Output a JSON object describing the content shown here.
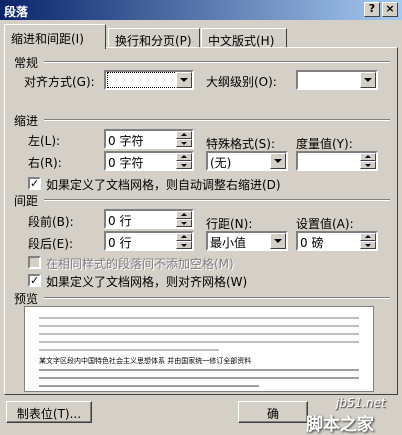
{
  "window": {
    "title": "段落",
    "help_button": "?",
    "close_button": "×"
  },
  "tabs": [
    {
      "label": "缩进和间距(I)"
    },
    {
      "label": "换行和分页(P)"
    },
    {
      "label": "中文版式(H)"
    }
  ],
  "general": {
    "title": "常规",
    "alignment_label": "对齐方式(G):",
    "alignment_value": "",
    "outline_label": "大纲级别(O):",
    "outline_value": ""
  },
  "indent": {
    "title": "缩进",
    "left_label": "左(L):",
    "left_value": "0 字符",
    "right_label": "右(R):",
    "right_value": "0 字符",
    "special_label": "特殊格式(S):",
    "special_value": "(无)",
    "measure_label": "度量值(Y):",
    "measure_value": "",
    "auto_adjust_label": "如果定义了文档网格，则自动调整右缩进(D)",
    "auto_adjust_checked": true
  },
  "spacing": {
    "title": "间距",
    "before_label": "段前(B):",
    "before_value": "0 行",
    "after_label": "段后(E):",
    "after_value": "0 行",
    "line_label": "行距(N):",
    "line_value": "最小值",
    "at_label": "设置值(A):",
    "at_value": "0 磅",
    "no_space_label": "在相同样式的段落间不添加空格(M)",
    "no_space_checked": false,
    "snap_grid_label": "如果定义了文档网格，则对齐网格(W)",
    "snap_grid_checked": true
  },
  "preview": {
    "title": "预览",
    "sample_text": "某文字区段内中国特色社会主义思想体系   并由国家统一修订全部资料"
  },
  "buttons": {
    "tabs_label": "制表位(T)...",
    "ok_label": "确"
  },
  "watermark": {
    "site": "jb51.net",
    "name": "脚本之家"
  }
}
